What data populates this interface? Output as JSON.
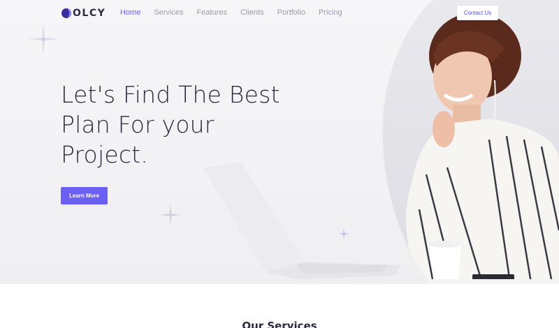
{
  "brand": {
    "logo_text": "OLCY",
    "accent": "#6c5ff3"
  },
  "nav": {
    "links": [
      {
        "label": "Home",
        "active": true
      },
      {
        "label": "Services",
        "active": false
      },
      {
        "label": "Features",
        "active": false
      },
      {
        "label": "Clients",
        "active": false
      },
      {
        "label": "Portfolio",
        "active": false
      },
      {
        "label": "Pricing",
        "active": false
      }
    ],
    "contact_label": "Contact Us"
  },
  "hero": {
    "headline": [
      "Let's Find The Best",
      "Plan For your",
      "Project."
    ],
    "cta_label": "Learn More"
  },
  "services": {
    "title": "Our Services"
  }
}
